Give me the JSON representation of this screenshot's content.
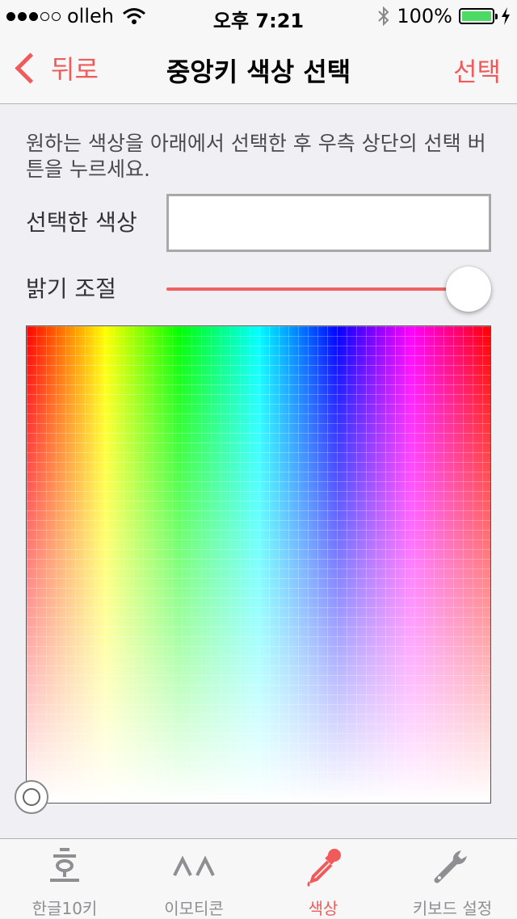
{
  "status_bar": {
    "carrier": "olleh",
    "time": "오후 7:21",
    "battery": "100%",
    "battery_level": 1.0,
    "signal_bars": 3
  },
  "nav": {
    "back_label": "뒤로",
    "title": "중앙키 색상 선택",
    "select_label": "선택"
  },
  "content": {
    "description": "원하는 색상을 아래에서 선택한 후 우측 상단의 선택 버튼을 누르세요.",
    "selected_color_label": "선택한 색상",
    "selected_color": "#ffffff",
    "brightness_label": "밝기 조절",
    "brightness_value": 1.0
  },
  "tabs": [
    {
      "label": "한글10키",
      "icon": "hangul-icon",
      "active": false
    },
    {
      "label": "이모티콘",
      "icon": "emoticon-icon",
      "active": false
    },
    {
      "label": "색상",
      "icon": "eyedropper-icon",
      "active": true
    },
    {
      "label": "키보드 설정",
      "icon": "wrench-icon",
      "active": false
    }
  ],
  "colors": {
    "accent": "#f05a5a",
    "battery": "#4cd964"
  }
}
